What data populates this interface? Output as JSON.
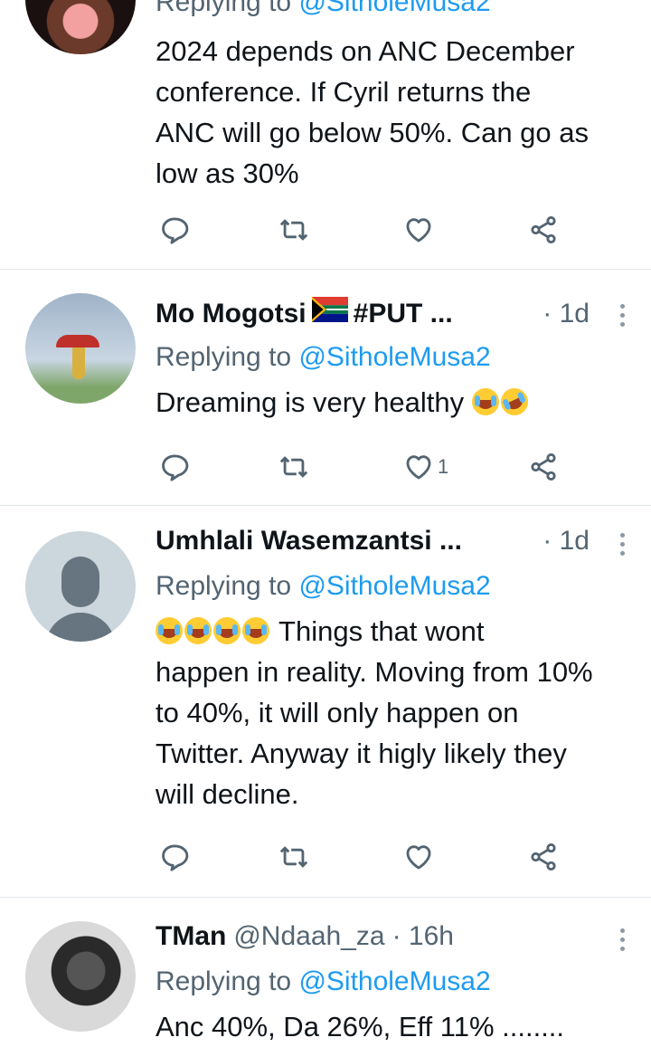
{
  "tweets": [
    {
      "reply_prefix": "Replying to ",
      "reply_to": "@SitholeMusa2",
      "text": "2024 depends on ANC December\nconference. If Cyril returns the\nANC will go below 50%. Can go as\nlow as 30%",
      "likes": ""
    },
    {
      "name": "Mo Mogotsi",
      "name_suffix": "#PUT ...",
      "time": "· 1d",
      "reply_prefix": "Replying to ",
      "reply_to": "@SitholeMusa2",
      "text": "Dreaming is very healthy",
      "likes": "1"
    },
    {
      "name": "Umhlali Wasemzantsi ...",
      "time": "· 1d",
      "reply_prefix": "Replying to ",
      "reply_to": "@SitholeMusa2",
      "text_first": " Things that wont",
      "text": "happen in reality. Moving from 10%\nto 40%, it will only happen on\nTwitter. Anyway it higly likely they\nwill decline.",
      "likes": ""
    },
    {
      "name": "TMan",
      "handle": "@Ndaah_za",
      "time": "· 16h",
      "reply_prefix": "Replying to ",
      "reply_to": "@SitholeMusa2",
      "text": "Anc 40%, Da 26%, Eff 11% ........"
    }
  ],
  "colors": {
    "accent": "#1d9bf0",
    "muted": "#536471",
    "divider": "#e1e6ea"
  },
  "icons": [
    "reply-icon",
    "retweet-icon",
    "like-icon",
    "share-icon",
    "more-icon"
  ]
}
